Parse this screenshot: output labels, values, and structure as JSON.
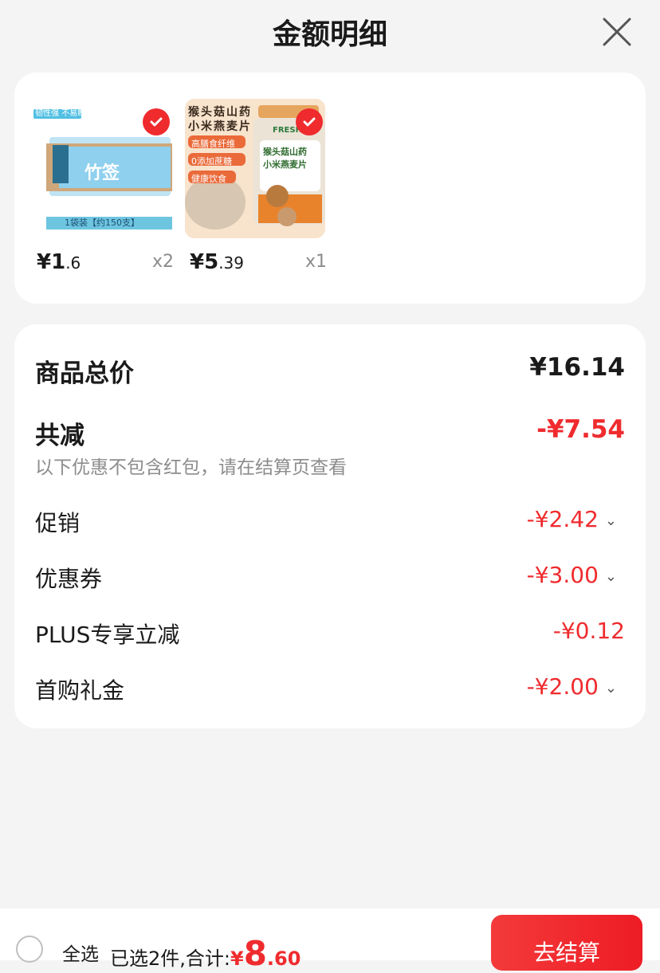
{
  "header": {
    "title": "金额明细"
  },
  "products": [
    {
      "price_int": "¥1",
      "price_dec": ".6",
      "qty": "x2",
      "badge_text": "韧性强 不易断",
      "brand_text": "竹签",
      "bottom_text": "1袋装【约150支】"
    },
    {
      "price_int": "¥5",
      "price_dec": ".39",
      "qty": "x1",
      "line1": "猴头菇山药",
      "line2": "小米燕麦片",
      "tag1": "高膳食纤维",
      "tag2": "0添加蔗糖",
      "tag3": "健康饮食",
      "jar_brand": "FRESH",
      "jar_line1": "猴头菇山药",
      "jar_line2": "小米燕麦片"
    }
  ],
  "summary": {
    "total_label": "商品总价",
    "total_value": "¥16.14",
    "reduce_label": "共减",
    "reduce_value": "-¥7.54",
    "note": "以下优惠不包含红包，请在结算页查看",
    "items": [
      {
        "label": "促销",
        "value": "-¥2.42",
        "chevron": "chevron-down-icon"
      },
      {
        "label": "优惠券",
        "value": "-¥3.00",
        "chevron": "chevron-down-icon"
      },
      {
        "label": "PLUS专享立减",
        "value": "-¥0.12"
      },
      {
        "label": "首购礼金",
        "value": "-¥2.00",
        "chevron": "chevron-down-icon"
      }
    ]
  },
  "footer": {
    "select_all": "全选",
    "selected_text": "已选2件,合计:",
    "total_symbol": "¥",
    "total_int": "8",
    "total_dec": ".60",
    "checkout": "去结算"
  },
  "colors": {
    "accent": "#ef2b2e",
    "bg": "#f4f4f4"
  }
}
